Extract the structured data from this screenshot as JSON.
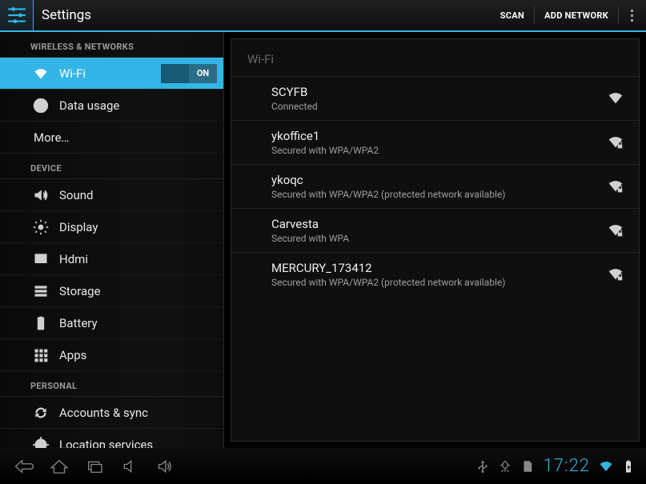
{
  "header": {
    "title": "Settings",
    "scan_label": "SCAN",
    "add_network_label": "ADD NETWORK"
  },
  "sidebar": {
    "sections": [
      {
        "header": "WIRELESS & NETWORKS",
        "items": [
          {
            "label": "Wi-Fi",
            "icon": "wifi",
            "selected": true,
            "toggle": "ON"
          },
          {
            "label": "Data usage",
            "icon": "data"
          },
          {
            "label": "More…",
            "icon": ""
          }
        ]
      },
      {
        "header": "DEVICE",
        "items": [
          {
            "label": "Sound",
            "icon": "sound"
          },
          {
            "label": "Display",
            "icon": "display"
          },
          {
            "label": "Hdmi",
            "icon": "hdmi"
          },
          {
            "label": "Storage",
            "icon": "storage"
          },
          {
            "label": "Battery",
            "icon": "battery"
          },
          {
            "label": "Apps",
            "icon": "apps"
          }
        ]
      },
      {
        "header": "PERSONAL",
        "items": [
          {
            "label": "Accounts & sync",
            "icon": "sync"
          },
          {
            "label": "Location services",
            "icon": "location"
          }
        ]
      }
    ]
  },
  "content": {
    "header": "Wi-Fi",
    "networks": [
      {
        "name": "SCYFB",
        "status": "Connected",
        "secured": false
      },
      {
        "name": "ykoffice1",
        "status": "Secured with WPA/WPA2",
        "secured": true
      },
      {
        "name": "ykoqc",
        "status": "Secured with WPA/WPA2 (protected network available)",
        "secured": true
      },
      {
        "name": "Carvesta",
        "status": "Secured with WPA",
        "secured": true
      },
      {
        "name": "MERCURY_173412",
        "status": "Secured with WPA/WPA2 (protected network available)",
        "secured": true
      }
    ]
  },
  "navbar": {
    "clock": "17:22"
  }
}
